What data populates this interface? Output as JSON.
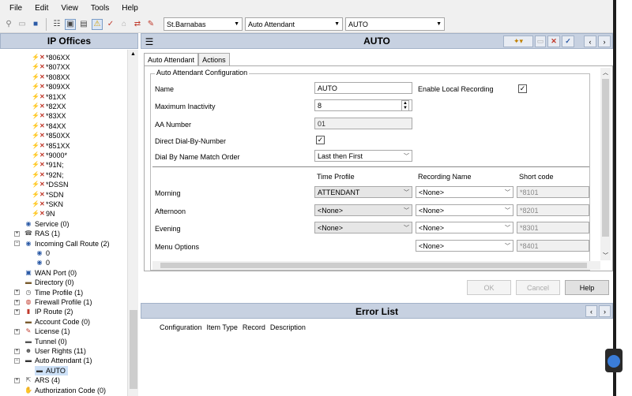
{
  "menu": [
    "File",
    "Edit",
    "View",
    "Tools",
    "Help"
  ],
  "toolbar": {
    "combo1": "St.Barnabas",
    "combo2": "Auto Attendant",
    "combo3": "AUTO"
  },
  "left_panel": {
    "title": "IP Offices",
    "tree": [
      {
        "label": "*806XX",
        "type": "x"
      },
      {
        "label": "*807XX",
        "type": "x"
      },
      {
        "label": "*808XX",
        "type": "x"
      },
      {
        "label": "*809XX",
        "type": "x"
      },
      {
        "label": "*81XX",
        "type": "x"
      },
      {
        "label": "*82XX",
        "type": "x"
      },
      {
        "label": "*83XX",
        "type": "x"
      },
      {
        "label": "*84XX",
        "type": "x"
      },
      {
        "label": "*850XX",
        "type": "x"
      },
      {
        "label": "*851XX",
        "type": "x"
      },
      {
        "label": "*9000*",
        "type": "x"
      },
      {
        "label": "*91N;",
        "type": "x"
      },
      {
        "label": "*92N;",
        "type": "x"
      },
      {
        "label": "*DSSN",
        "type": "x"
      },
      {
        "label": "*SDN",
        "type": "x"
      },
      {
        "label": "*SKN",
        "type": "x"
      },
      {
        "label": "9N",
        "type": "x"
      },
      {
        "label": "Service (0)",
        "type": "globe"
      },
      {
        "label": "RAS (1)",
        "type": "ras"
      },
      {
        "label": "Incoming Call Route (2)",
        "type": "icr"
      },
      {
        "label": "0",
        "type": "sub"
      },
      {
        "label": "0",
        "type": "sub"
      },
      {
        "label": "WAN Port (0)",
        "type": "wan"
      },
      {
        "label": "Directory (0)",
        "type": "dir"
      },
      {
        "label": "Time Profile (1)",
        "type": "time"
      },
      {
        "label": "Firewall Profile (1)",
        "type": "fw"
      },
      {
        "label": "IP Route (2)",
        "type": "ip"
      },
      {
        "label": "Account Code (0)",
        "type": "acct"
      },
      {
        "label": "License (1)",
        "type": "lic"
      },
      {
        "label": "Tunnel (0)",
        "type": "tun"
      },
      {
        "label": "User Rights (11)",
        "type": "ur"
      },
      {
        "label": "Auto Attendant (1)",
        "type": "aa"
      },
      {
        "label": "AUTO",
        "type": "aaitem"
      },
      {
        "label": "ARS (4)",
        "type": "ars"
      },
      {
        "label": "Authorization Code (0)",
        "type": "auth"
      }
    ]
  },
  "main": {
    "title": "AUTO",
    "tabs": [
      "Auto Attendant",
      "Actions"
    ],
    "group_label": "Auto Attendant Configuration",
    "fields": {
      "name_label": "Name",
      "name_value": "AUTO",
      "enable_rec_label": "Enable Local Recording",
      "max_inact_label": "Maximum Inactivity",
      "max_inact_value": "8",
      "aa_number_label": "AA Number",
      "aa_number_value": "01",
      "direct_dial_label": "Direct Dial-By-Number",
      "dial_order_label": "Dial By Name Match Order",
      "dial_order_value": "Last then First"
    },
    "columns": {
      "time_profile": "Time Profile",
      "recording_name": "Recording Name",
      "short_code": "Short code"
    },
    "rows": [
      {
        "label": "Morning",
        "time_profile": "ATTENDANT",
        "recording": "<None>",
        "short_code": "*8101"
      },
      {
        "label": "Afternoon",
        "time_profile": "<None>",
        "recording": "<None>",
        "short_code": "*8201"
      },
      {
        "label": "Evening",
        "time_profile": "<None>",
        "recording": "<None>",
        "short_code": "*8301"
      },
      {
        "label": "Menu Options",
        "time_profile": "",
        "recording": "<None>",
        "short_code": "*8401"
      }
    ],
    "buttons": {
      "ok": "OK",
      "cancel": "Cancel",
      "help": "Help"
    }
  },
  "error_list": {
    "title": "Error List",
    "columns": [
      "Configuration",
      "Item Type",
      "Record",
      "Description"
    ]
  }
}
